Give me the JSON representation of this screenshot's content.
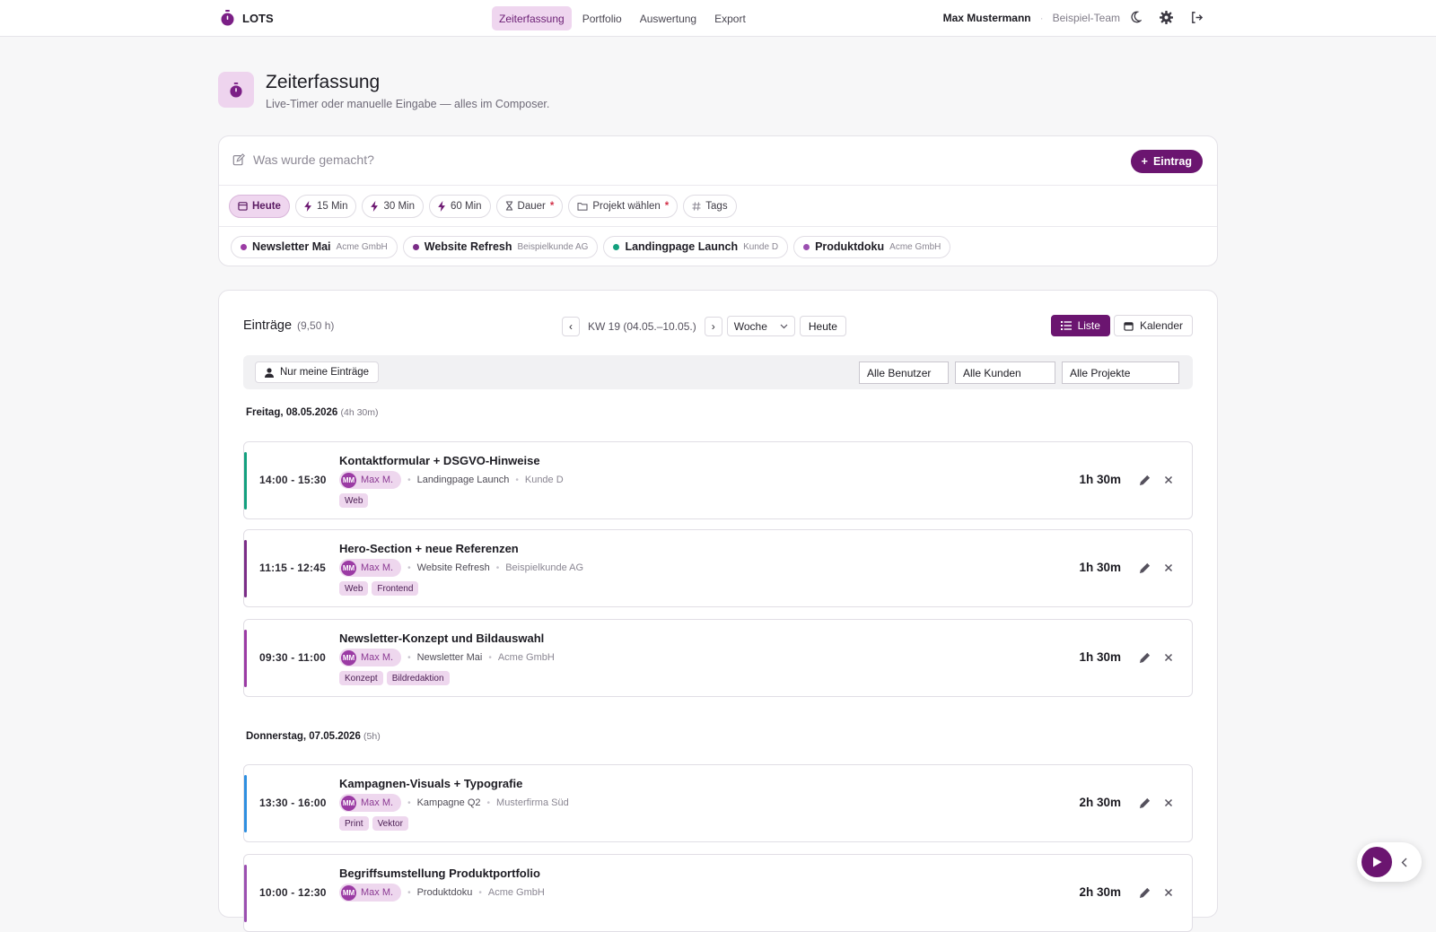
{
  "app": {
    "name": "LOTS"
  },
  "nav": [
    {
      "label": "Zeiterfassung",
      "active": true
    },
    {
      "label": "Portfolio",
      "active": false
    },
    {
      "label": "Auswertung",
      "active": false
    },
    {
      "label": "Export",
      "active": false
    }
  ],
  "user": {
    "name": "Max Mustermann",
    "team": "Beispiel-Team",
    "separator": "·"
  },
  "header": {
    "title": "Zeiterfassung",
    "subtitle": "Live-Timer oder manuelle Eingabe — alles im Composer."
  },
  "composer": {
    "placeholder": "Was wurde gemacht?",
    "add_label": "Eintrag",
    "chips": {
      "today": "Heute",
      "m15": "15 Min",
      "m30": "30 Min",
      "m60": "60 Min",
      "duration": "Dauer",
      "project": "Projekt wählen",
      "tags": "Tags",
      "required_mark": "*"
    },
    "projects": [
      {
        "name": "Newsletter Mai",
        "client": "Acme GmbH",
        "color": "#9b3ba4"
      },
      {
        "name": "Website Refresh",
        "client": "Beispielkunde AG",
        "color": "#7b2d87"
      },
      {
        "name": "Landingpage Launch",
        "client": "Kunde D",
        "color": "#13a07e"
      },
      {
        "name": "Produktdoku",
        "client": "Acme GmbH",
        "color": "#9b4fb0"
      }
    ]
  },
  "entries": {
    "title": "Einträge",
    "total": "(9,50 h)",
    "prev": "‹",
    "next": "›",
    "week_label": "KW 19 (04.05.–10.05.)",
    "range_select": "Woche",
    "today_btn": "Heute",
    "view_list": "Liste",
    "view_calendar": "Kalender",
    "filter_mine": "Nur meine Einträge",
    "filter_users": "Alle Benutzer",
    "filter_clients": "Alle Kunden",
    "filter_projects": "Alle Projekte",
    "days": [
      {
        "label": "Freitag, 08.05.2026",
        "sum": "(4h 30m)",
        "items": [
          {
            "time": "14:00 - 15:30",
            "title": "Kontaktformular + DSGVO-Hinweise",
            "initials": "MM",
            "user": "Max M.",
            "project": "Landingpage Launch",
            "client": "Kunde D",
            "tags": [
              "Web"
            ],
            "duration": "1h 30m",
            "color": "#13a07e"
          },
          {
            "time": "11:15 - 12:45",
            "title": "Hero-Section + neue Referenzen",
            "initials": "MM",
            "user": "Max M.",
            "project": "Website Refresh",
            "client": "Beispielkunde AG",
            "tags": [
              "Web",
              "Frontend"
            ],
            "duration": "1h 30m",
            "color": "#7b2d87"
          },
          {
            "time": "09:30 - 11:00",
            "title": "Newsletter-Konzept und Bildauswahl",
            "initials": "MM",
            "user": "Max M.",
            "project": "Newsletter Mai",
            "client": "Acme GmbH",
            "tags": [
              "Konzept",
              "Bildredaktion"
            ],
            "duration": "1h 30m",
            "color": "#9b3ba4"
          }
        ]
      },
      {
        "label": "Donnerstag, 07.05.2026",
        "sum": "(5h)",
        "items": [
          {
            "time": "13:30 - 16:00",
            "title": "Kampagnen-Visuals + Typografie",
            "initials": "MM",
            "user": "Max M.",
            "project": "Kampagne Q2",
            "client": "Musterfirma Süd",
            "tags": [
              "Print",
              "Vektor"
            ],
            "duration": "2h 30m",
            "color": "#2e8fe0"
          },
          {
            "time": "10:00 - 12:30",
            "title": "Begriffsumstellung Produktportfolio",
            "initials": "MM",
            "user": "Max M.",
            "project": "Produktdoku",
            "client": "Acme GmbH",
            "tags": [],
            "duration": "2h 30m",
            "color": "#9b4fb0"
          }
        ]
      }
    ]
  }
}
